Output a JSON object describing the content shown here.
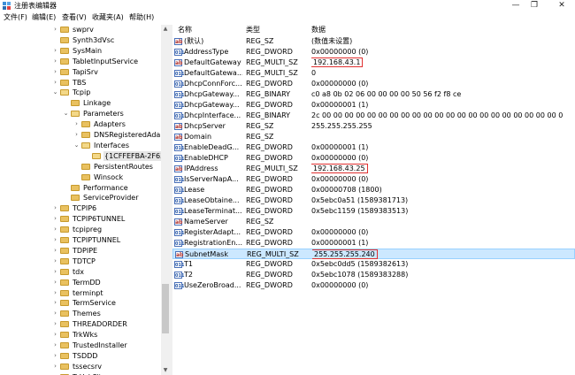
{
  "window": {
    "title": "注册表编辑器",
    "min_glyph": "—",
    "max_glyph": "❐",
    "close_glyph": "✕"
  },
  "menu": [
    "文件(F)",
    "编辑(E)",
    "查看(V)",
    "收藏夹(A)",
    "帮助(H)"
  ],
  "tree": [
    {
      "label": "swprv",
      "depth": 0,
      "expander": "›",
      "state": "closed"
    },
    {
      "label": "Synth3dVsc",
      "depth": 0,
      "expander": "",
      "state": "closed"
    },
    {
      "label": "SysMain",
      "depth": 0,
      "expander": "›",
      "state": "closed"
    },
    {
      "label": "TabletInputService",
      "depth": 0,
      "expander": "›",
      "state": "closed"
    },
    {
      "label": "TapiSrv",
      "depth": 0,
      "expander": "›",
      "state": "closed"
    },
    {
      "label": "TBS",
      "depth": 0,
      "expander": "›",
      "state": "closed"
    },
    {
      "label": "Tcpip",
      "depth": 0,
      "expander": "⌄",
      "state": "open"
    },
    {
      "label": "Linkage",
      "depth": 1,
      "expander": "",
      "state": "closed"
    },
    {
      "label": "Parameters",
      "depth": 1,
      "expander": "⌄",
      "state": "open"
    },
    {
      "label": "Adapters",
      "depth": 2,
      "expander": "›",
      "state": "closed"
    },
    {
      "label": "DNSRegisteredAda",
      "depth": 2,
      "expander": "›",
      "state": "closed"
    },
    {
      "label": "Interfaces",
      "depth": 2,
      "expander": "⌄",
      "state": "open"
    },
    {
      "label": "{1CFFEFBA-2F63",
      "depth": 3,
      "expander": "",
      "state": "selected"
    },
    {
      "label": "PersistentRoutes",
      "depth": 2,
      "expander": "",
      "state": "closed"
    },
    {
      "label": "Winsock",
      "depth": 2,
      "expander": "",
      "state": "closed"
    },
    {
      "label": "Performance",
      "depth": 1,
      "expander": "",
      "state": "closed"
    },
    {
      "label": "ServiceProvider",
      "depth": 1,
      "expander": "",
      "state": "closed"
    },
    {
      "label": "TCPIP6",
      "depth": 0,
      "expander": "›",
      "state": "closed"
    },
    {
      "label": "TCPIP6TUNNEL",
      "depth": 0,
      "expander": "›",
      "state": "closed"
    },
    {
      "label": "tcpipreg",
      "depth": 0,
      "expander": "›",
      "state": "closed"
    },
    {
      "label": "TCPIPTUNNEL",
      "depth": 0,
      "expander": "›",
      "state": "closed"
    },
    {
      "label": "TDPIPE",
      "depth": 0,
      "expander": "›",
      "state": "closed"
    },
    {
      "label": "TDTCP",
      "depth": 0,
      "expander": "›",
      "state": "closed"
    },
    {
      "label": "tdx",
      "depth": 0,
      "expander": "›",
      "state": "closed"
    },
    {
      "label": "TermDD",
      "depth": 0,
      "expander": "›",
      "state": "closed"
    },
    {
      "label": "terminpt",
      "depth": 0,
      "expander": "›",
      "state": "closed"
    },
    {
      "label": "TermService",
      "depth": 0,
      "expander": "›",
      "state": "closed"
    },
    {
      "label": "Themes",
      "depth": 0,
      "expander": "›",
      "state": "closed"
    },
    {
      "label": "THREADORDER",
      "depth": 0,
      "expander": "›",
      "state": "closed"
    },
    {
      "label": "TrkWks",
      "depth": 0,
      "expander": "›",
      "state": "closed"
    },
    {
      "label": "TrustedInstaller",
      "depth": 0,
      "expander": "›",
      "state": "closed"
    },
    {
      "label": "TSDDD",
      "depth": 0,
      "expander": "›",
      "state": "closed"
    },
    {
      "label": "tssecsrv",
      "depth": 0,
      "expander": "›",
      "state": "closed"
    },
    {
      "label": "TsUsbFlt",
      "depth": 0,
      "expander": "›",
      "state": "closed"
    },
    {
      "label": "TsUsbGD",
      "depth": 0,
      "expander": "›",
      "state": "closed"
    }
  ],
  "columns": {
    "name": "名称",
    "type": "类型",
    "data": "数据"
  },
  "values": [
    {
      "name": "(默认)",
      "type": "REG_SZ",
      "data": "(数值未设置)",
      "kind": "sz",
      "highlight": false
    },
    {
      "name": "AddressType",
      "type": "REG_DWORD",
      "data": "0x00000000 (0)",
      "kind": "bin",
      "highlight": false
    },
    {
      "name": "DefaultGateway",
      "type": "REG_MULTI_SZ",
      "data": "192.168.43.1",
      "kind": "sz",
      "highlight": true
    },
    {
      "name": "DefaultGatewa...",
      "type": "REG_MULTI_SZ",
      "data": "0",
      "kind": "bin",
      "highlight": false
    },
    {
      "name": "DhcpConnForc...",
      "type": "REG_DWORD",
      "data": "0x00000000 (0)",
      "kind": "bin",
      "highlight": false
    },
    {
      "name": "DhcpGateway...",
      "type": "REG_BINARY",
      "data": "c0 a8 0b 02 06 00 00 00 00 50 56 f2 f8 ce",
      "kind": "bin",
      "highlight": false
    },
    {
      "name": "DhcpGateway...",
      "type": "REG_DWORD",
      "data": "0x00000001 (1)",
      "kind": "bin",
      "highlight": false
    },
    {
      "name": "DhcpInterface...",
      "type": "REG_BINARY",
      "data": "2c 00 00 00 00 00 00 00 00 00 00 00 00 00 00 00 00 00 00 00 00 00 0",
      "kind": "bin",
      "highlight": false
    },
    {
      "name": "DhcpServer",
      "type": "REG_SZ",
      "data": "255.255.255.255",
      "kind": "sz",
      "highlight": false
    },
    {
      "name": "Domain",
      "type": "REG_SZ",
      "data": "",
      "kind": "sz",
      "highlight": false
    },
    {
      "name": "EnableDeadG...",
      "type": "REG_DWORD",
      "data": "0x00000001 (1)",
      "kind": "bin",
      "highlight": false
    },
    {
      "name": "EnableDHCP",
      "type": "REG_DWORD",
      "data": "0x00000000 (0)",
      "kind": "bin",
      "highlight": false
    },
    {
      "name": "IPAddress",
      "type": "REG_MULTI_SZ",
      "data": "192.168.43.25",
      "kind": "sz",
      "highlight": true
    },
    {
      "name": "IsServerNapA...",
      "type": "REG_DWORD",
      "data": "0x00000000 (0)",
      "kind": "bin",
      "highlight": false
    },
    {
      "name": "Lease",
      "type": "REG_DWORD",
      "data": "0x00000708 (1800)",
      "kind": "bin",
      "highlight": false
    },
    {
      "name": "LeaseObtaine...",
      "type": "REG_DWORD",
      "data": "0x5ebc0a51 (1589381713)",
      "kind": "bin",
      "highlight": false
    },
    {
      "name": "LeaseTerminat...",
      "type": "REG_DWORD",
      "data": "0x5ebc1159 (1589383513)",
      "kind": "bin",
      "highlight": false
    },
    {
      "name": "NameServer",
      "type": "REG_SZ",
      "data": "",
      "kind": "sz",
      "highlight": false
    },
    {
      "name": "RegisterAdapt...",
      "type": "REG_DWORD",
      "data": "0x00000000 (0)",
      "kind": "bin",
      "highlight": false
    },
    {
      "name": "RegistrationEn...",
      "type": "REG_DWORD",
      "data": "0x00000001 (1)",
      "kind": "bin",
      "highlight": false
    },
    {
      "name": "SubnetMask",
      "type": "REG_MULTI_SZ",
      "data": "255.255.255.240",
      "kind": "sz",
      "highlight": true,
      "selected": true
    },
    {
      "name": "T1",
      "type": "REG_DWORD",
      "data": "0x5ebc0dd5 (1589382613)",
      "kind": "bin",
      "highlight": false
    },
    {
      "name": "T2",
      "type": "REG_DWORD",
      "data": "0x5ebc1078 (1589383288)",
      "kind": "bin",
      "highlight": false
    },
    {
      "name": "UseZeroBroad...",
      "type": "REG_DWORD",
      "data": "0x00000000 (0)",
      "kind": "bin",
      "highlight": false
    }
  ],
  "icons": {
    "sz": "ab",
    "bin": "011"
  },
  "colors": {
    "selection": "#cce8ff",
    "highlight_box": "#e03030",
    "folder": "#e9c160"
  }
}
